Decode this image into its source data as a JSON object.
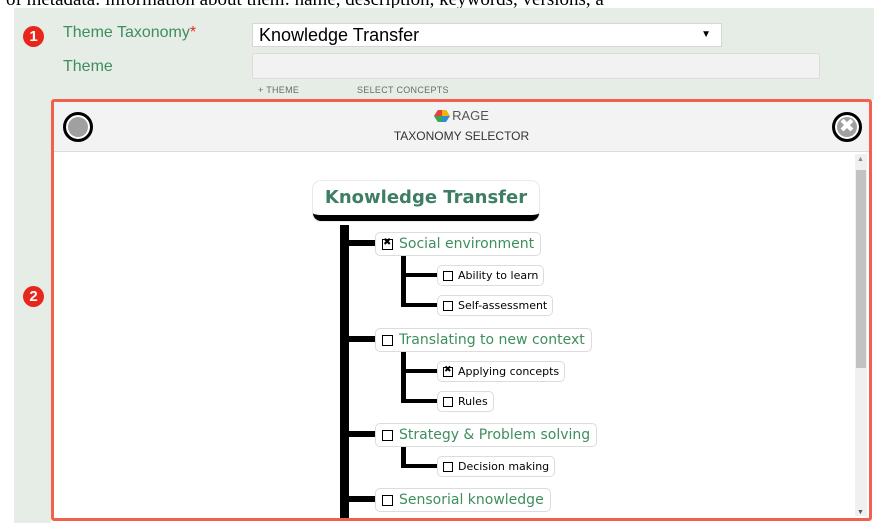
{
  "top_strip_text": "of metadata: information about them: name, description, keywords, versions, a",
  "markers": {
    "first": "1",
    "second": "2"
  },
  "form": {
    "taxonomy_label": "Theme Taxonomy",
    "required_mark": "*",
    "taxonomy_selected": "Knowledge Transfer",
    "theme_label": "Theme",
    "theme_value": "",
    "add_theme_link": "+ THEME",
    "select_concepts_link": "SELECT CONCEPTS"
  },
  "panel": {
    "brand": "RAGE",
    "subtitle": "TAXONOMY SELECTOR",
    "close_glyph": "✖"
  },
  "tree": {
    "root": "Knowledge Transfer",
    "nodes": [
      {
        "label": "Social environment",
        "checked": true,
        "children": [
          {
            "label": "Ability to learn",
            "checked": false
          },
          {
            "label": "Self-assessment",
            "checked": false
          }
        ]
      },
      {
        "label": "Translating to new context",
        "checked": false,
        "children": [
          {
            "label": "Applying concepts",
            "checked": true
          },
          {
            "label": "Rules",
            "checked": false
          }
        ]
      },
      {
        "label": "Strategy & Problem solving",
        "checked": false,
        "children": [
          {
            "label": "Decision making",
            "checked": false
          }
        ]
      },
      {
        "label": "Sensorial knowledge",
        "checked": false,
        "children": []
      }
    ]
  },
  "colors": {
    "accent_green": "#3e8e5e",
    "marker_red": "#e8261c",
    "panel_border": "#f2604e"
  },
  "icons": {
    "logo": "rage-logo-icon",
    "circle": "circle-button-icon",
    "close": "close-circle-icon"
  }
}
